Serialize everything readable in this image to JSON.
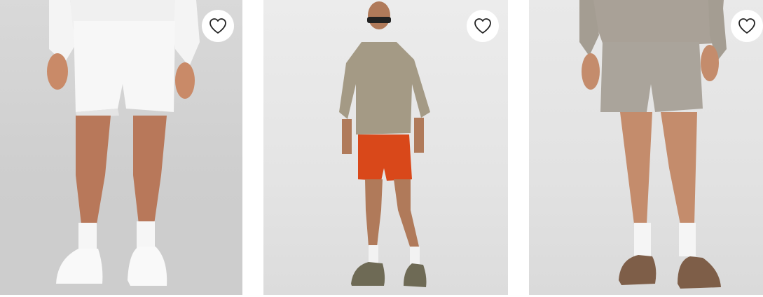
{
  "products": [
    {
      "product_color": "white",
      "icon": "heart-outline-icon"
    },
    {
      "product_color": "orange",
      "icon": "heart-outline-icon"
    },
    {
      "product_color": "taupe",
      "icon": "heart-outline-icon"
    }
  ],
  "colors": {
    "heart_stroke": "#222222",
    "fav_bg": "#ffffff"
  }
}
